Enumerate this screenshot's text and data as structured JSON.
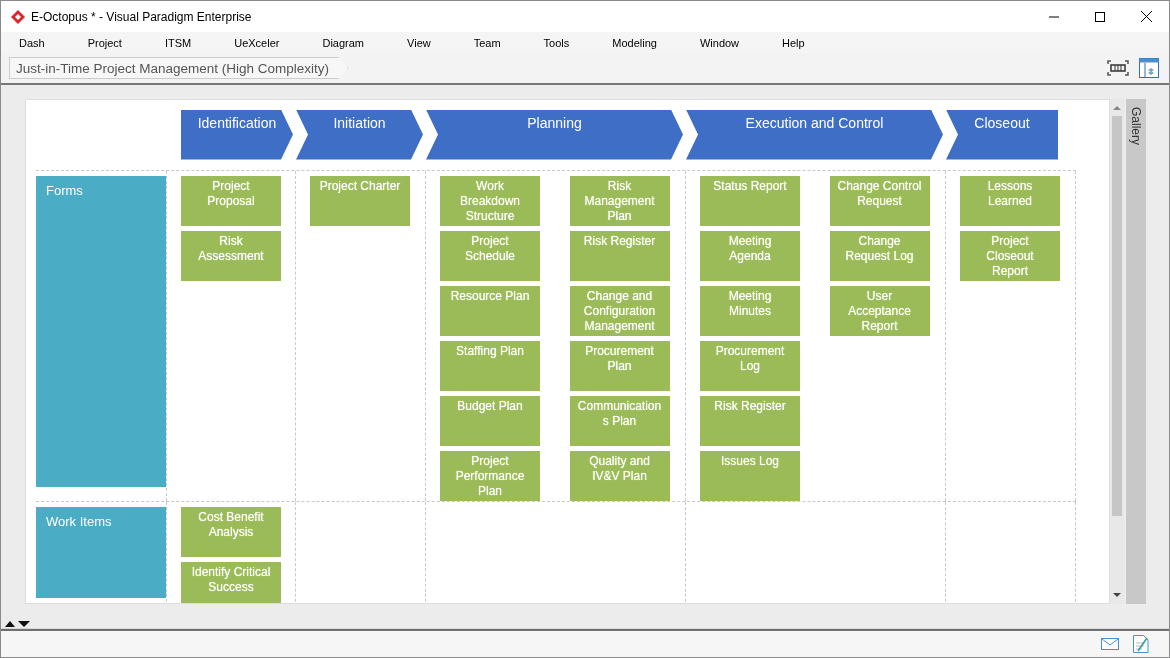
{
  "window": {
    "title": "E-Octopus * - Visual Paradigm Enterprise"
  },
  "menu": [
    "Dash",
    "Project",
    "ITSM",
    "UeXceler",
    "Diagram",
    "View",
    "Team",
    "Tools",
    "Modeling",
    "Window",
    "Help"
  ],
  "breadcrumb": "Just-in-Time Project Management (High Complexity)",
  "gallery_tab": "Gallery",
  "phases": [
    "Identification",
    "Initiation",
    "Planning",
    "Execution and Control",
    "Closeout"
  ],
  "lanes": [
    {
      "name": "Forms",
      "cells": [
        [
          [
            "Project Proposal",
            "Risk Assessment"
          ]
        ],
        [
          [
            "Project Charter"
          ]
        ],
        [
          [
            "Work Breakdown Structure",
            "Project Schedule",
            "Resource Plan",
            "Staffing Plan",
            "Budget Plan",
            "Project Performance Plan"
          ],
          [
            "Risk Management Plan",
            "Risk Register",
            "Change and Configuration Management",
            "Procurement Plan",
            "Communications Plan",
            "Quality and IV&V Plan"
          ]
        ],
        [
          [
            "Status Report",
            "Meeting Agenda",
            "Meeting Minutes",
            "Procurement Log",
            "Risk Register",
            "Issues Log"
          ],
          [
            "Change Control Request",
            "Change Request Log",
            "User Acceptance Report"
          ]
        ],
        [
          [
            "Lessons Learned",
            "Project Closeout Report"
          ]
        ]
      ]
    },
    {
      "name": "Work Items",
      "cells": [
        [
          [
            "Cost Benefit Analysis",
            "Identify Critical Success"
          ]
        ]
      ]
    }
  ]
}
